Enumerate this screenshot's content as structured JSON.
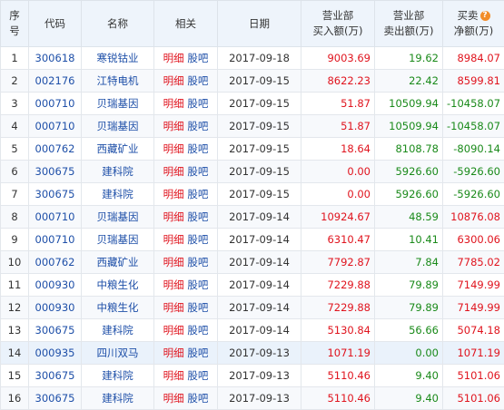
{
  "headers": {
    "seq": "序号",
    "code": "代码",
    "name": "名称",
    "related": "相关",
    "date": "日期",
    "buy_line1": "营业部",
    "buy_line2": "买入额(万)",
    "sell_line1": "营业部",
    "sell_line2": "卖出额(万)",
    "net_line1": "买卖",
    "net_line2": "净额(万)"
  },
  "link_detail": "明细",
  "link_forum": "股吧",
  "rows": [
    {
      "seq": "1",
      "code": "300618",
      "name": "寒锐钴业",
      "date": "2017-09-18",
      "buy": "9003.69",
      "sell": "19.62",
      "net": "8984.07"
    },
    {
      "seq": "2",
      "code": "002176",
      "name": "江特电机",
      "date": "2017-09-15",
      "buy": "8622.23",
      "sell": "22.42",
      "net": "8599.81"
    },
    {
      "seq": "3",
      "code": "000710",
      "name": "贝瑞基因",
      "date": "2017-09-15",
      "buy": "51.87",
      "sell": "10509.94",
      "net": "-10458.07"
    },
    {
      "seq": "4",
      "code": "000710",
      "name": "贝瑞基因",
      "date": "2017-09-15",
      "buy": "51.87",
      "sell": "10509.94",
      "net": "-10458.07"
    },
    {
      "seq": "5",
      "code": "000762",
      "name": "西藏矿业",
      "date": "2017-09-15",
      "buy": "18.64",
      "sell": "8108.78",
      "net": "-8090.14"
    },
    {
      "seq": "6",
      "code": "300675",
      "name": "建科院",
      "date": "2017-09-15",
      "buy": "0.00",
      "sell": "5926.60",
      "net": "-5926.60"
    },
    {
      "seq": "7",
      "code": "300675",
      "name": "建科院",
      "date": "2017-09-15",
      "buy": "0.00",
      "sell": "5926.60",
      "net": "-5926.60"
    },
    {
      "seq": "8",
      "code": "000710",
      "name": "贝瑞基因",
      "date": "2017-09-14",
      "buy": "10924.67",
      "sell": "48.59",
      "net": "10876.08"
    },
    {
      "seq": "9",
      "code": "000710",
      "name": "贝瑞基因",
      "date": "2017-09-14",
      "buy": "6310.47",
      "sell": "10.41",
      "net": "6300.06"
    },
    {
      "seq": "10",
      "code": "000762",
      "name": "西藏矿业",
      "date": "2017-09-14",
      "buy": "7792.87",
      "sell": "7.84",
      "net": "7785.02"
    },
    {
      "seq": "11",
      "code": "000930",
      "name": "中粮生化",
      "date": "2017-09-14",
      "buy": "7229.88",
      "sell": "79.89",
      "net": "7149.99"
    },
    {
      "seq": "12",
      "code": "000930",
      "name": "中粮生化",
      "date": "2017-09-14",
      "buy": "7229.88",
      "sell": "79.89",
      "net": "7149.99"
    },
    {
      "seq": "13",
      "code": "300675",
      "name": "建科院",
      "date": "2017-09-14",
      "buy": "5130.84",
      "sell": "56.66",
      "net": "5074.18"
    },
    {
      "seq": "14",
      "code": "000935",
      "name": "四川双马",
      "date": "2017-09-13",
      "buy": "1071.19",
      "sell": "0.00",
      "net": "1071.19"
    },
    {
      "seq": "15",
      "code": "300675",
      "name": "建科院",
      "date": "2017-09-13",
      "buy": "5110.46",
      "sell": "9.40",
      "net": "5101.06"
    },
    {
      "seq": "16",
      "code": "300675",
      "name": "建科院",
      "date": "2017-09-13",
      "buy": "5110.46",
      "sell": "9.40",
      "net": "5101.06"
    }
  ],
  "colors": {
    "red": "#e0141e",
    "green": "#1a8a1a",
    "link": "#1e4fa8",
    "header_bg": "#eef4fb",
    "highlight_bg": "#eaf2fb"
  },
  "highlighted_row": "14",
  "icons": {
    "help": "question-icon"
  }
}
